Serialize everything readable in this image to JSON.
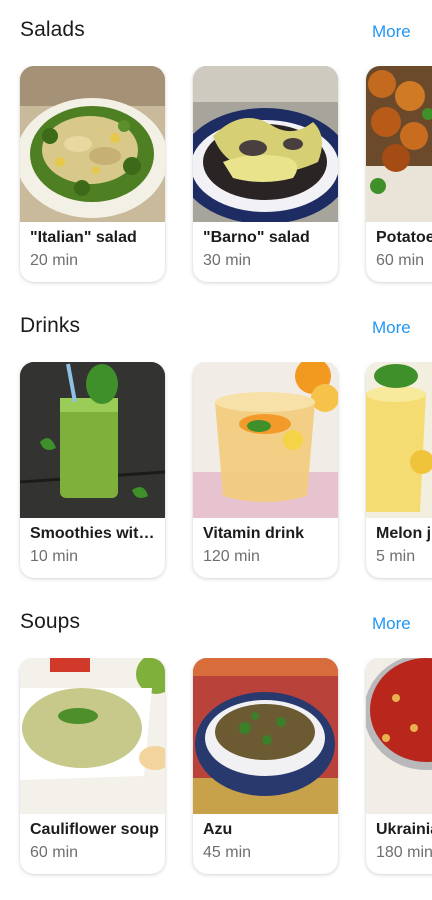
{
  "sections": [
    {
      "title": "Salads",
      "more_label": "More",
      "cards": [
        {
          "title": "\"Italian\" salad",
          "time": "20 min"
        },
        {
          "title": "\"Barno\" salad",
          "time": "30 min"
        },
        {
          "title": "Potatoes",
          "time": "60 min"
        }
      ]
    },
    {
      "title": "Drinks",
      "more_label": "More",
      "cards": [
        {
          "title": "Smoothies with spinach",
          "time": "10 min"
        },
        {
          "title": "Vitamin drink",
          "time": "120 min"
        },
        {
          "title": "Melon juice",
          "time": "5 min"
        }
      ]
    },
    {
      "title": "Soups",
      "more_label": "More",
      "cards": [
        {
          "title": "Cauliflower soup",
          "time": "60 min"
        },
        {
          "title": "Azu",
          "time": "45 min"
        },
        {
          "title": "Ukrainian borscht",
          "time": "180 min"
        }
      ]
    }
  ],
  "colors": {
    "accent": "#2196f3",
    "title": "#1b1b1b",
    "subtitle": "#6f6f6f",
    "card_background": "#ffffff"
  }
}
